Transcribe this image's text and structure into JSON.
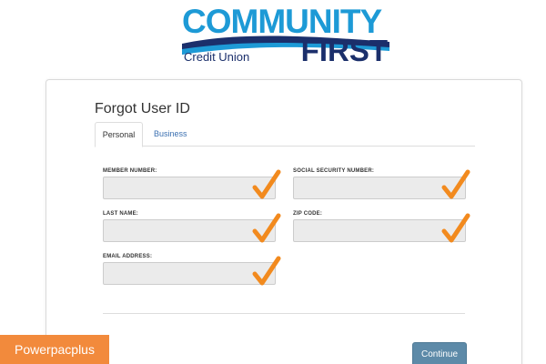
{
  "brand": {
    "line1": "COMMUNITY",
    "line2": "FIRST",
    "subtitle": "Credit Union",
    "colors": {
      "light_blue": "#1d9ad6",
      "navy": "#1b2f6b"
    }
  },
  "form": {
    "title": "Forgot User ID",
    "tabs": [
      {
        "label": "Personal",
        "active": true
      },
      {
        "label": "Business",
        "active": false
      }
    ],
    "fields": [
      {
        "label": "MEMBER NUMBER:",
        "value": "",
        "valid_icon": "orange-check-icon"
      },
      {
        "label": "SOCIAL SECURITY NUMBER:",
        "value": "",
        "valid_icon": "orange-check-icon"
      },
      {
        "label": "LAST NAME:",
        "value": "",
        "valid_icon": "orange-check-icon"
      },
      {
        "label": "ZIP CODE:",
        "value": "",
        "valid_icon": "orange-check-icon"
      },
      {
        "label": "EMAIL ADDRESS:",
        "value": "",
        "valid_icon": "orange-check-icon"
      }
    ],
    "continue_label": "Continue",
    "colors": {
      "check": "#f28a1e",
      "button": "#5d8aa8",
      "tab_link": "#3a6fb0"
    }
  },
  "watermark": {
    "text": "Powerpacplus",
    "color": "#f28a3c"
  }
}
